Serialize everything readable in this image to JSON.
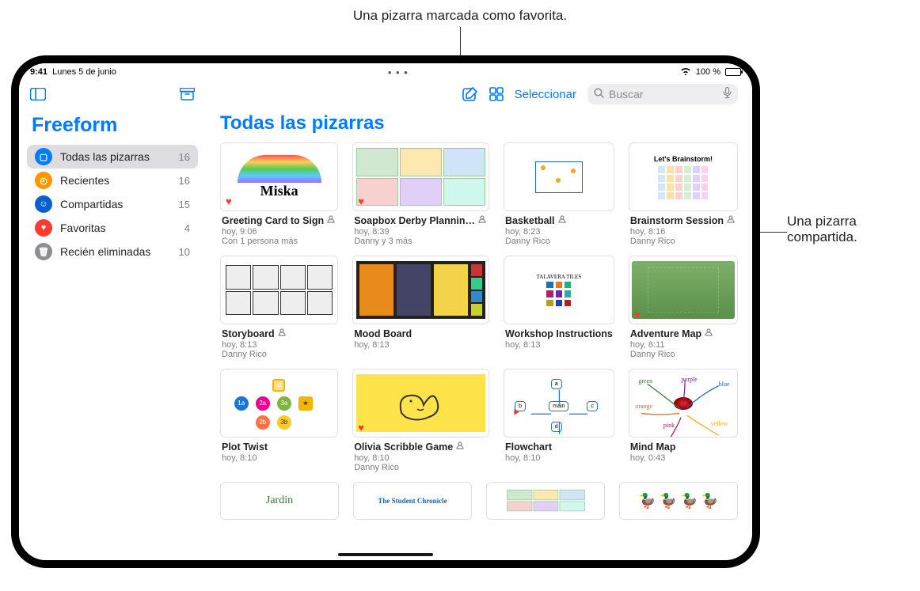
{
  "callouts": {
    "top": "Una pizarra marcada como favorita.",
    "right_line1": "Una pizarra",
    "right_line2": "compartida."
  },
  "status": {
    "time": "9:41",
    "date": "Lunes 5 de junio",
    "battery": "100 %"
  },
  "toolbar": {
    "select_label": "Seleccionar",
    "search_placeholder": "Buscar"
  },
  "sidebar": {
    "app_title": "Freeform",
    "items": [
      {
        "icon": "all",
        "label": "Todas las pizarras",
        "count": "16",
        "active": true
      },
      {
        "icon": "recent",
        "label": "Recientes",
        "count": "16",
        "active": false
      },
      {
        "icon": "shared",
        "label": "Compartidas",
        "count": "15",
        "active": false
      },
      {
        "icon": "fav",
        "label": "Favoritas",
        "count": "4",
        "active": false
      },
      {
        "icon": "del",
        "label": "Recién eliminadas",
        "count": "10",
        "active": false
      }
    ]
  },
  "content": {
    "title": "Todas las pizarras",
    "items": [
      {
        "title": "Greeting Card to Sign",
        "time": "hoy, 9:06",
        "sub": "Con 1 persona más",
        "fav": true,
        "shared": true,
        "thumbkind": "greeting",
        "thumbtext": "Miska"
      },
      {
        "title": "Soapbox Derby Plannin…",
        "time": "hoy, 8:39",
        "sub": "Danny y 3 más",
        "fav": true,
        "shared": true,
        "thumbkind": "collage",
        "thumbtext": ""
      },
      {
        "title": "Basketball",
        "time": "hoy, 8:23",
        "sub": "Danny Rico",
        "fav": false,
        "shared": true,
        "thumbkind": "bball",
        "thumbtext": ""
      },
      {
        "title": "Brainstorm Session",
        "time": "hoy, 8:16",
        "sub": "Danny Rico",
        "fav": false,
        "shared": true,
        "thumbkind": "brainstorm",
        "thumbtext": "Let's Brainstorm!"
      },
      {
        "title": "Storyboard",
        "time": "hoy, 8:13",
        "sub": "Danny Rico",
        "fav": false,
        "shared": true,
        "thumbkind": "storyboard",
        "thumbtext": ""
      },
      {
        "title": "Mood Board",
        "time": "hoy, 8:13",
        "sub": "",
        "fav": false,
        "shared": false,
        "thumbkind": "mood",
        "thumbtext": ""
      },
      {
        "title": "Workshop Instructions",
        "time": "hoy, 8:13",
        "sub": "",
        "fav": false,
        "shared": false,
        "thumbkind": "tiles",
        "thumbtext": "TALAVERA TILES"
      },
      {
        "title": "Adventure Map",
        "time": "hoy, 8:11",
        "sub": "Danny Rico",
        "fav": true,
        "shared": true,
        "thumbkind": "adventure",
        "thumbtext": ""
      },
      {
        "title": "Plot Twist",
        "time": "hoy, 8:10",
        "sub": "",
        "fav": false,
        "shared": false,
        "thumbkind": "plottwist",
        "thumbtext": ""
      },
      {
        "title": "Olivia Scribble Game",
        "time": "hoy, 8:10",
        "sub": "Danny Rico",
        "fav": true,
        "shared": true,
        "thumbkind": "scribble",
        "thumbtext": ""
      },
      {
        "title": "Flowchart",
        "time": "hoy, 8:10",
        "sub": "",
        "fav": false,
        "shared": false,
        "thumbkind": "flowchart",
        "thumbtext": ""
      },
      {
        "title": "Mind Map",
        "time": "hoy, 0:43",
        "sub": "",
        "fav": false,
        "shared": false,
        "thumbkind": "mindmap",
        "thumbtext": ""
      }
    ]
  },
  "colors": {
    "accent": "#007aff",
    "favorite": "#ff3b30"
  }
}
